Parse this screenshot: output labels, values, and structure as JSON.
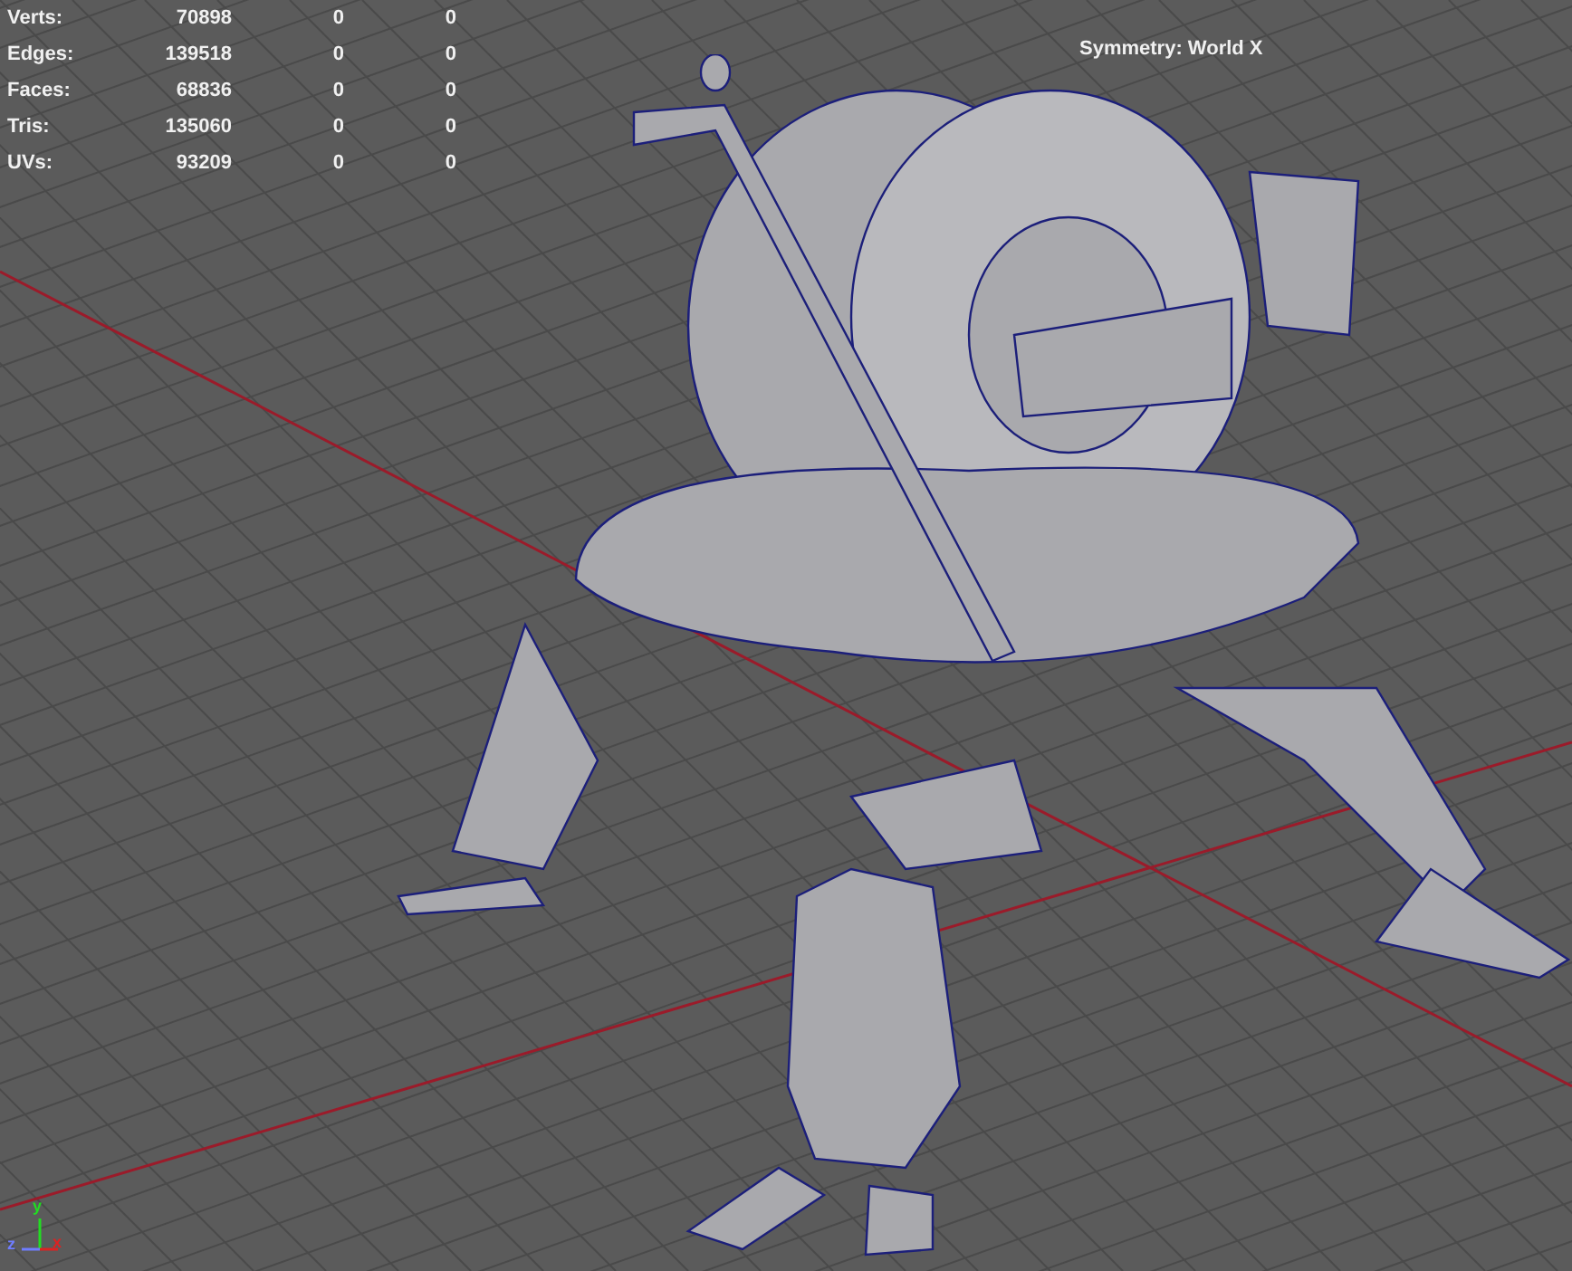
{
  "hud": {
    "rows": [
      {
        "label": "Verts:",
        "values": [
          "70898",
          "0",
          "0"
        ]
      },
      {
        "label": "Edges:",
        "values": [
          "139518",
          "0",
          "0"
        ]
      },
      {
        "label": "Faces:",
        "values": [
          "68836",
          "0",
          "0"
        ]
      },
      {
        "label": "Tris:",
        "values": [
          "135060",
          "0",
          "0"
        ]
      },
      {
        "label": "UVs:",
        "values": [
          "93209",
          "0",
          "0"
        ]
      }
    ]
  },
  "symmetry": "Symmetry: World X",
  "axes": {
    "y": "y",
    "z": "z",
    "x": "x"
  }
}
